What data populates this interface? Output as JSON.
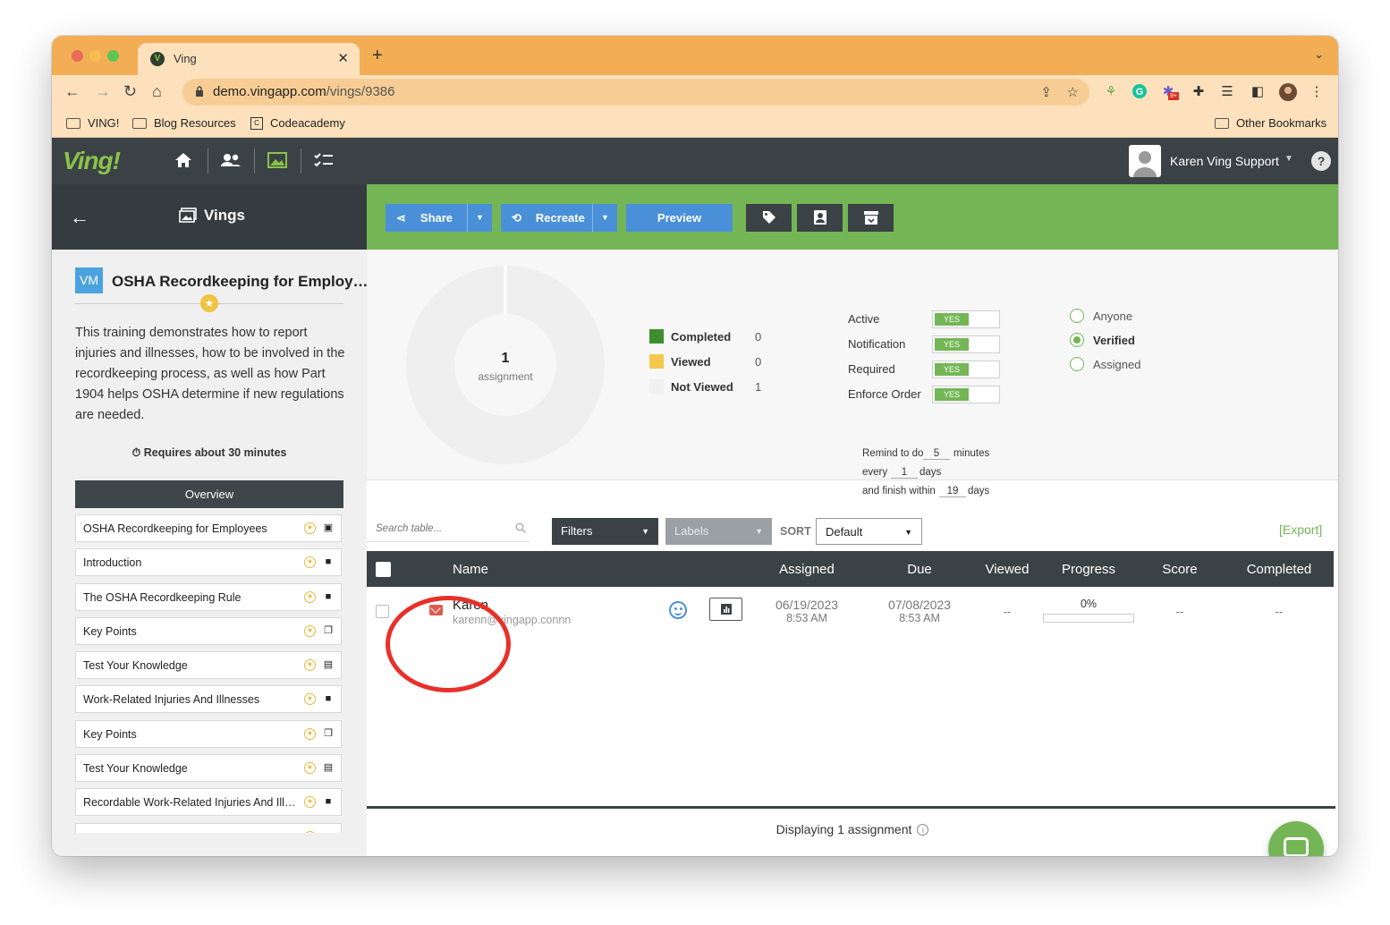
{
  "browser": {
    "tab_title": "Ving",
    "tab_favicon": "V",
    "url_host": "demo.vingapp.com",
    "url_path": "/vings/9386",
    "bookmarks": [
      "VING!",
      "Blog Resources",
      "Codeacademy"
    ],
    "other_bookmarks": "Other Bookmarks",
    "extension_badge": "9+"
  },
  "header": {
    "logo": "Ving!",
    "user_name": "Karen Ving Support",
    "help": "?"
  },
  "sidebar_head": {
    "title": "Vings"
  },
  "course": {
    "badge": "VM",
    "title": "OSHA Recordkeeping for Employ…",
    "description": "This training demonstrates how to report injuries and illnesses, how to be involved in the recordkeeping process, as well as how Part 1904 helps OSHA determine if new regulations are needed.",
    "duration": "Requires about 30 minutes",
    "overview_label": "Overview",
    "items": [
      {
        "label": "OSHA Recordkeeping for Employees",
        "type_icon": "image-icon"
      },
      {
        "label": "Introduction",
        "type_icon": "video-icon"
      },
      {
        "label": "The OSHA Recordkeeping Rule",
        "type_icon": "video-icon"
      },
      {
        "label": "Key Points",
        "type_icon": "copy-icon"
      },
      {
        "label": "Test Your Knowledge",
        "type_icon": "clipboard-icon"
      },
      {
        "label": "Work-Related Injuries And Illnesses",
        "type_icon": "video-icon"
      },
      {
        "label": "Key Points",
        "type_icon": "copy-icon"
      },
      {
        "label": "Test Your Knowledge",
        "type_icon": "clipboard-icon"
      },
      {
        "label": "Recordable Work-Related Injuries And Illn...",
        "type_icon": "video-icon"
      },
      {
        "label": "",
        "type_icon": "video-icon"
      }
    ]
  },
  "actions": {
    "share": "Share",
    "recreate": "Recreate",
    "preview": "Preview"
  },
  "stats": {
    "count": "1",
    "count_label": "assignment",
    "legend": [
      {
        "label": "Completed",
        "value": "0",
        "color": "#3e8e2f"
      },
      {
        "label": "Viewed",
        "value": "0",
        "color": "#f2c94c"
      },
      {
        "label": "Not Viewed",
        "value": "1",
        "color": "#f1f1f1"
      }
    ]
  },
  "options": {
    "toggles": [
      {
        "label": "Active",
        "value": "YES"
      },
      {
        "label": "Notification",
        "value": "YES"
      },
      {
        "label": "Required",
        "value": "YES"
      },
      {
        "label": "Enforce Order",
        "value": "YES"
      }
    ],
    "remind_prefix": "Remind to do",
    "remind_value": "5",
    "remind_unit": "minutes",
    "every_prefix": "every",
    "every_value": "1",
    "every_unit": "days",
    "finish_prefix": "and finish within",
    "finish_value": "19",
    "finish_unit": "days",
    "visibility": [
      {
        "label": "Anyone",
        "selected": false
      },
      {
        "label": "Verified",
        "selected": true
      },
      {
        "label": "Assigned",
        "selected": false
      }
    ]
  },
  "table_controls": {
    "search_placeholder": "Search table...",
    "filters": "Filters",
    "labels": "Labels",
    "sort_label": "SORT",
    "sort_value": "Default",
    "export": "[Export]"
  },
  "table": {
    "columns": [
      "Name",
      "Assigned",
      "Due",
      "Viewed",
      "Progress",
      "Score",
      "Completed"
    ],
    "rows": [
      {
        "name": "Karen",
        "email": "karenn@vingapp.connn",
        "assigned_date": "06/19/2023",
        "assigned_time": "8:53 AM",
        "due_date": "07/08/2023",
        "due_time": "8:53 AM",
        "viewed": "--",
        "progress_label": "0%",
        "progress": 0,
        "score": "--",
        "completed": "--"
      }
    ],
    "footer": "Displaying 1 assignment"
  }
}
